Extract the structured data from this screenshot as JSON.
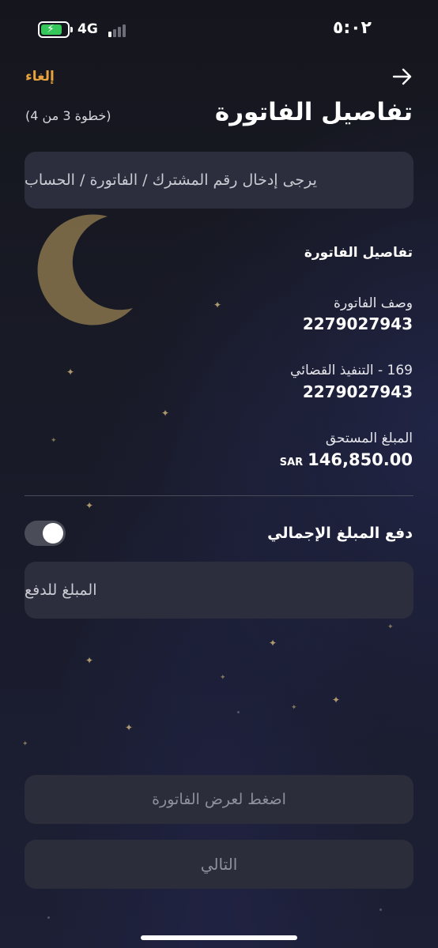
{
  "status_bar": {
    "network": "4G",
    "time": "٥:٠٢"
  },
  "header": {
    "cancel_label": "إلغاء",
    "title": "تفاصيل الفاتورة",
    "step": "(خطوة 3 من 4)"
  },
  "account_input": {
    "placeholder": "يرجى إدخال رقم المشترك / الفاتورة / الحساب"
  },
  "bill_details": {
    "heading": "تفاصيل الفاتورة",
    "description_label": "وصف الفاتورة",
    "description_value": "2279027943",
    "service_label": "169 - التنفيذ القضائي",
    "service_value": "2279027943",
    "due_label": "المبلغ المستحق",
    "due_currency": "SAR",
    "due_amount": "146,850.00"
  },
  "pay_full": {
    "label": "دفع المبلغ الإجمالي",
    "enabled": false
  },
  "amount_input": {
    "placeholder": "المبلغ للدفع"
  },
  "buttons": {
    "view_bill": "اضغط لعرض الفاتورة",
    "next": "التالي"
  },
  "colors": {
    "accent": "#e8a33e",
    "moon": "#b59a5e",
    "battery": "#35c759"
  }
}
